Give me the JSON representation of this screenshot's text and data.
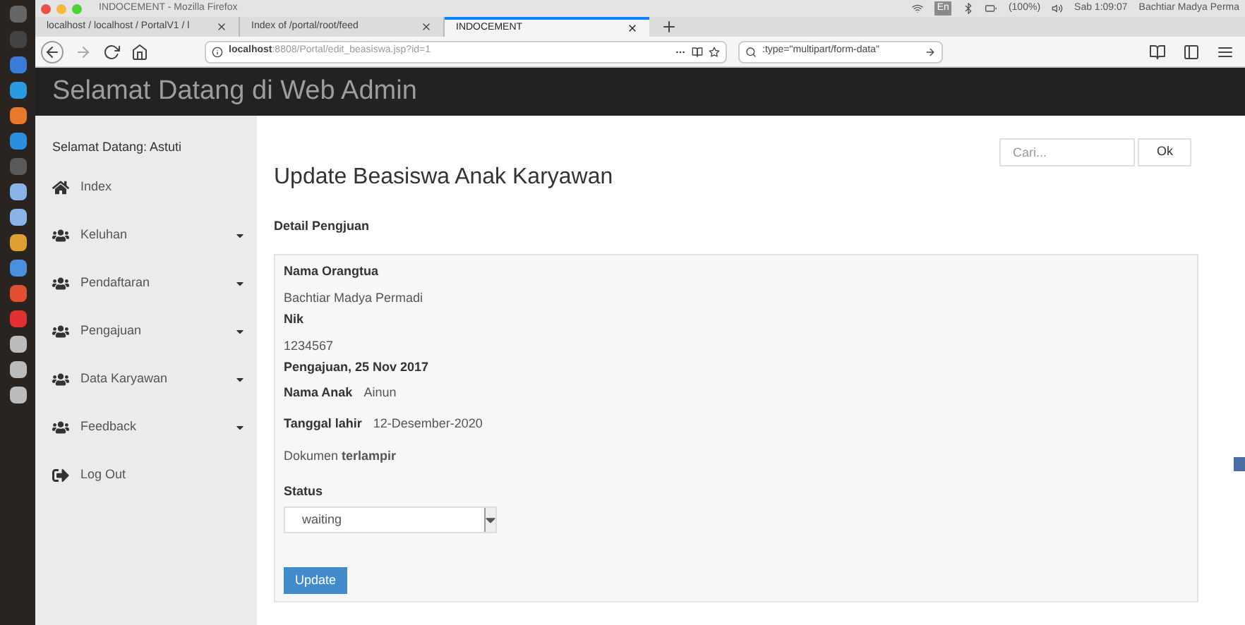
{
  "window": {
    "title": "INDOCEMENT - Mozilla Firefox"
  },
  "system_tray": {
    "keyboard": "En",
    "battery": "(100%)",
    "clock": "Sab 1:09:07",
    "user": "Bachtiar Madya Perma"
  },
  "tabs": [
    {
      "label": "localhost / localhost / PortalV1 / l",
      "selected": false
    },
    {
      "label": "Index of /portal/root/feed",
      "selected": false
    },
    {
      "label": "INDOCEMENT",
      "selected": true
    }
  ],
  "address_bar": {
    "host": "localhost",
    "path": ":8808/Portal/edit_beasiswa.jsp?id=1"
  },
  "search_bar": {
    "value": ":type=\"multipart/form-data\""
  },
  "header": {
    "title": "Selamat Datang di Web Admin"
  },
  "sidebar": {
    "greeting": "Selamat Datang: Astuti",
    "items": [
      {
        "kind": "home",
        "label": "Index"
      },
      {
        "kind": "group",
        "label": "Keluhan"
      },
      {
        "kind": "group",
        "label": "Pendaftaran"
      },
      {
        "kind": "group",
        "label": "Pengajuan"
      },
      {
        "kind": "group",
        "label": "Data Karyawan"
      },
      {
        "kind": "group",
        "label": "Feedback"
      },
      {
        "kind": "logout",
        "label": "Log Out"
      }
    ]
  },
  "search": {
    "placeholder": "Cari...",
    "button": "Ok"
  },
  "page": {
    "title": "Update Beasiswa Anak Karyawan",
    "section": "Detail Pengjuan"
  },
  "details": [
    {
      "kind": "label",
      "text": "Nama Orangtua"
    },
    {
      "kind": "value",
      "text": "Bachtiar Madya Permadi"
    },
    {
      "kind": "label",
      "text": "Nik"
    },
    {
      "kind": "value",
      "text": "1234567"
    },
    {
      "kind": "label",
      "text": "Pengajuan, 25 Nov 2017"
    },
    {
      "kind": "pair",
      "label": "Nama Anak",
      "text": "Ainun"
    },
    {
      "kind": "pair",
      "label": "Tanggal lahir",
      "text": "12-Desember-2020"
    },
    {
      "kind": "sentence",
      "text": "Dokumen **terlampir**"
    }
  ],
  "status": {
    "label": "Status",
    "value": "waiting"
  },
  "submit": {
    "label": "Update"
  }
}
